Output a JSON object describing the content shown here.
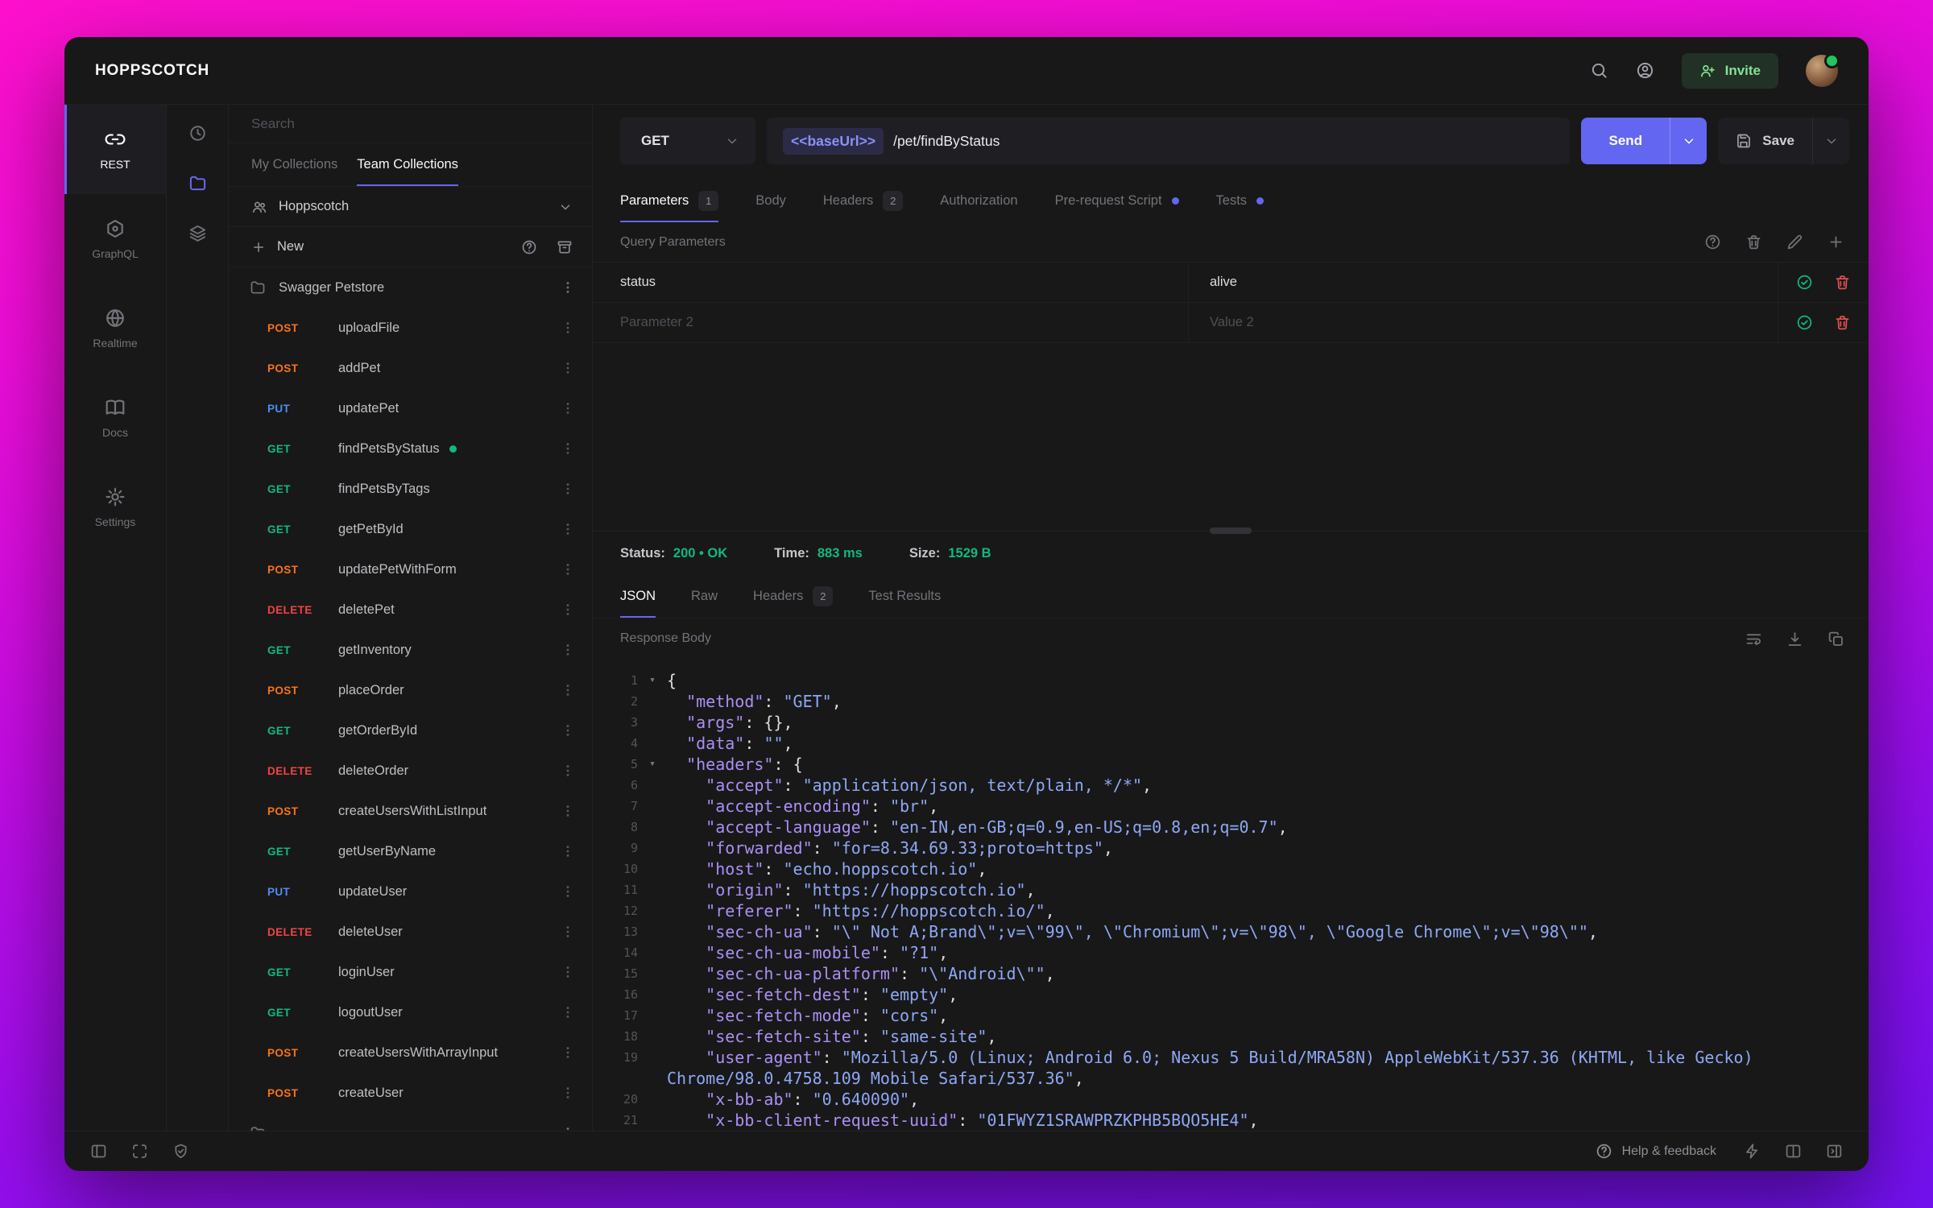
{
  "colors": {
    "accent": "#6366f1",
    "method_get": "#10b981",
    "method_post": "#f97316",
    "method_put": "#4d8df6",
    "method_delete": "#ef4444",
    "success": "#10b981",
    "invite_green": "#84e296",
    "background_gradient": [
      "#ff10cd",
      "#7411f2"
    ]
  },
  "header": {
    "logo": "HOPPSCOTCH",
    "icons": [
      "search-icon",
      "user-circle-icon"
    ],
    "invite_label": "Invite"
  },
  "primary_nav": [
    {
      "label": "REST",
      "icon": "link-icon",
      "active": true
    },
    {
      "label": "GraphQL",
      "icon": "graphql-icon",
      "active": false
    },
    {
      "label": "Realtime",
      "icon": "globe-icon",
      "active": false
    },
    {
      "label": "Docs",
      "icon": "book-icon",
      "active": false
    },
    {
      "label": "Settings",
      "icon": "gear-icon",
      "active": false
    }
  ],
  "rail_icons": [
    "history-icon",
    "folder-icon",
    "layers-icon"
  ],
  "collections": {
    "search_placeholder": "Search",
    "tabs": [
      {
        "label": "My Collections",
        "active": false
      },
      {
        "label": "Team Collections",
        "active": true
      }
    ],
    "team_name": "Hoppscotch",
    "new_label": "New",
    "new_row_icons": [
      "help-icon",
      "archive-icon"
    ],
    "tree": [
      {
        "type": "folder",
        "name": "Swagger Petstore"
      },
      {
        "type": "request",
        "method": "POST",
        "name": "uploadFile"
      },
      {
        "type": "request",
        "method": "POST",
        "name": "addPet"
      },
      {
        "type": "request",
        "method": "PUT",
        "name": "updatePet"
      },
      {
        "type": "request",
        "method": "GET",
        "name": "findPetsByStatus",
        "dot": true
      },
      {
        "type": "request",
        "method": "GET",
        "name": "findPetsByTags"
      },
      {
        "type": "request",
        "method": "GET",
        "name": "getPetById"
      },
      {
        "type": "request",
        "method": "POST",
        "name": "updatePetWithForm"
      },
      {
        "type": "request",
        "method": "DELETE",
        "name": "deletePet"
      },
      {
        "type": "request",
        "method": "GET",
        "name": "getInventory"
      },
      {
        "type": "request",
        "method": "POST",
        "name": "placeOrder"
      },
      {
        "type": "request",
        "method": "GET",
        "name": "getOrderById"
      },
      {
        "type": "request",
        "method": "DELETE",
        "name": "deleteOrder"
      },
      {
        "type": "request",
        "method": "POST",
        "name": "createUsersWithListInput"
      },
      {
        "type": "request",
        "method": "GET",
        "name": "getUserByName"
      },
      {
        "type": "request",
        "method": "PUT",
        "name": "updateUser"
      },
      {
        "type": "request",
        "method": "DELETE",
        "name": "deleteUser"
      },
      {
        "type": "request",
        "method": "GET",
        "name": "loginUser"
      },
      {
        "type": "request",
        "method": "GET",
        "name": "logoutUser"
      },
      {
        "type": "request",
        "method": "POST",
        "name": "createUsersWithArrayInput"
      },
      {
        "type": "request",
        "method": "POST",
        "name": "createUser"
      },
      {
        "type": "folder",
        "name": ""
      }
    ]
  },
  "request": {
    "method": "GET",
    "url_chip": "<<baseUrl>>",
    "url_path": "/pet/findByStatus",
    "send_label": "Send",
    "save_label": "Save",
    "tabs": [
      {
        "label": "Parameters",
        "badge": "1",
        "active": true
      },
      {
        "label": "Body"
      },
      {
        "label": "Headers",
        "badge": "2"
      },
      {
        "label": "Authorization"
      },
      {
        "label": "Pre-request Script",
        "dot": true
      },
      {
        "label": "Tests",
        "dot": true
      }
    ],
    "section_title": "Query Parameters",
    "param_toolbar_icons": [
      "help-icon",
      "delete-all-icon",
      "edit-icon",
      "add-icon"
    ],
    "param_row_icons": [
      "check-circle-icon",
      "delete-icon"
    ],
    "params": [
      {
        "key": "status",
        "value": "alive",
        "is_placeholder": false
      },
      {
        "key": "Parameter 2",
        "value": "Value 2",
        "is_placeholder": true
      }
    ]
  },
  "response": {
    "meta": [
      {
        "label": "Status:",
        "value": "200 • OK"
      },
      {
        "label": "Time:",
        "value": "883 ms"
      },
      {
        "label": "Size:",
        "value": "1529 B"
      }
    ],
    "tabs": [
      {
        "label": "JSON",
        "active": true
      },
      {
        "label": "Raw"
      },
      {
        "label": "Headers",
        "badge": "2"
      },
      {
        "label": "Test Results"
      }
    ],
    "body_label": "Response Body",
    "toolbar_icons": [
      "wrap-lines-icon",
      "download-icon",
      "copy-icon"
    ],
    "code_lines": [
      {
        "n": "1",
        "f": true,
        "t": [
          [
            "p",
            "{"
          ]
        ]
      },
      {
        "n": "2",
        "t": [
          [
            "p",
            "  "
          ],
          [
            "k",
            "\"method\""
          ],
          [
            "p",
            ": "
          ],
          [
            "s",
            "\"GET\""
          ],
          [
            "p",
            ","
          ]
        ]
      },
      {
        "n": "3",
        "t": [
          [
            "p",
            "  "
          ],
          [
            "k",
            "\"args\""
          ],
          [
            "p",
            ": "
          ],
          [
            "p",
            "{},"
          ]
        ]
      },
      {
        "n": "4",
        "t": [
          [
            "p",
            "  "
          ],
          [
            "k",
            "\"data\""
          ],
          [
            "p",
            ": "
          ],
          [
            "s",
            "\"\""
          ],
          [
            "p",
            ","
          ]
        ]
      },
      {
        "n": "5",
        "f": true,
        "t": [
          [
            "p",
            "  "
          ],
          [
            "k",
            "\"headers\""
          ],
          [
            "p",
            ": "
          ],
          [
            "p",
            "{"
          ]
        ]
      },
      {
        "n": "6",
        "t": [
          [
            "p",
            "    "
          ],
          [
            "k",
            "\"accept\""
          ],
          [
            "p",
            ": "
          ],
          [
            "s",
            "\"application/json, text/plain, */*\""
          ],
          [
            "p",
            ","
          ]
        ]
      },
      {
        "n": "7",
        "t": [
          [
            "p",
            "    "
          ],
          [
            "k",
            "\"accept-encoding\""
          ],
          [
            "p",
            ": "
          ],
          [
            "s",
            "\"br\""
          ],
          [
            "p",
            ","
          ]
        ]
      },
      {
        "n": "8",
        "t": [
          [
            "p",
            "    "
          ],
          [
            "k",
            "\"accept-language\""
          ],
          [
            "p",
            ": "
          ],
          [
            "s",
            "\"en-IN,en-GB;q=0.9,en-US;q=0.8,en;q=0.7\""
          ],
          [
            "p",
            ","
          ]
        ]
      },
      {
        "n": "9",
        "t": [
          [
            "p",
            "    "
          ],
          [
            "k",
            "\"forwarded\""
          ],
          [
            "p",
            ": "
          ],
          [
            "s",
            "\"for=8.34.69.33;proto=https\""
          ],
          [
            "p",
            ","
          ]
        ]
      },
      {
        "n": "10",
        "t": [
          [
            "p",
            "    "
          ],
          [
            "k",
            "\"host\""
          ],
          [
            "p",
            ": "
          ],
          [
            "s",
            "\"echo.hoppscotch.io\""
          ],
          [
            "p",
            ","
          ]
        ]
      },
      {
        "n": "11",
        "t": [
          [
            "p",
            "    "
          ],
          [
            "k",
            "\"origin\""
          ],
          [
            "p",
            ": "
          ],
          [
            "s",
            "\"https://hoppscotch.io\""
          ],
          [
            "p",
            ","
          ]
        ]
      },
      {
        "n": "12",
        "t": [
          [
            "p",
            "    "
          ],
          [
            "k",
            "\"referer\""
          ],
          [
            "p",
            ": "
          ],
          [
            "s",
            "\"https://hoppscotch.io/\""
          ],
          [
            "p",
            ","
          ]
        ]
      },
      {
        "n": "13",
        "t": [
          [
            "p",
            "    "
          ],
          [
            "k",
            "\"sec-ch-ua\""
          ],
          [
            "p",
            ": "
          ],
          [
            "s",
            "\"\\\" Not A;Brand\\\";v=\\\"99\\\", \\\"Chromium\\\";v=\\\"98\\\", \\\"Google Chrome\\\";v=\\\"98\\\"\""
          ],
          [
            "p",
            ","
          ]
        ]
      },
      {
        "n": "14",
        "t": [
          [
            "p",
            "    "
          ],
          [
            "k",
            "\"sec-ch-ua-mobile\""
          ],
          [
            "p",
            ": "
          ],
          [
            "s",
            "\"?1\""
          ],
          [
            "p",
            ","
          ]
        ]
      },
      {
        "n": "15",
        "t": [
          [
            "p",
            "    "
          ],
          [
            "k",
            "\"sec-ch-ua-platform\""
          ],
          [
            "p",
            ": "
          ],
          [
            "s",
            "\"\\\"Android\\\"\""
          ],
          [
            "p",
            ","
          ]
        ]
      },
      {
        "n": "16",
        "t": [
          [
            "p",
            "    "
          ],
          [
            "k",
            "\"sec-fetch-dest\""
          ],
          [
            "p",
            ": "
          ],
          [
            "s",
            "\"empty\""
          ],
          [
            "p",
            ","
          ]
        ]
      },
      {
        "n": "17",
        "t": [
          [
            "p",
            "    "
          ],
          [
            "k",
            "\"sec-fetch-mode\""
          ],
          [
            "p",
            ": "
          ],
          [
            "s",
            "\"cors\""
          ],
          [
            "p",
            ","
          ]
        ]
      },
      {
        "n": "18",
        "t": [
          [
            "p",
            "    "
          ],
          [
            "k",
            "\"sec-fetch-site\""
          ],
          [
            "p",
            ": "
          ],
          [
            "s",
            "\"same-site\""
          ],
          [
            "p",
            ","
          ]
        ]
      },
      {
        "n": "19",
        "t": [
          [
            "p",
            "    "
          ],
          [
            "k",
            "\"user-agent\""
          ],
          [
            "p",
            ": "
          ],
          [
            "s",
            "\"Mozilla/5.0 (Linux; Android 6.0; Nexus 5 Build/MRA58N) AppleWebKit/537.36 (KHTML, like Gecko) Chrome/98.0.4758.109 Mobile Safari/537.36\""
          ],
          [
            "p",
            ","
          ]
        ]
      },
      {
        "n": "20",
        "t": [
          [
            "p",
            "    "
          ],
          [
            "k",
            "\"x-bb-ab\""
          ],
          [
            "p",
            ": "
          ],
          [
            "s",
            "\"0.640090\""
          ],
          [
            "p",
            ","
          ]
        ]
      },
      {
        "n": "21",
        "t": [
          [
            "p",
            "    "
          ],
          [
            "k",
            "\"x-bb-client-request-uuid\""
          ],
          [
            "p",
            ": "
          ],
          [
            "s",
            "\"01FWYZ1SRAWPRZKPHB5BQO5HE4\""
          ],
          [
            "p",
            ","
          ]
        ]
      }
    ]
  },
  "footer": {
    "left_icons": [
      "panel-toggle-icon",
      "expand-icon",
      "shield-check-icon"
    ],
    "help_label": "Help & feedback",
    "right_icons": [
      "zap-icon",
      "columns-icon",
      "panel-right-icon"
    ]
  }
}
